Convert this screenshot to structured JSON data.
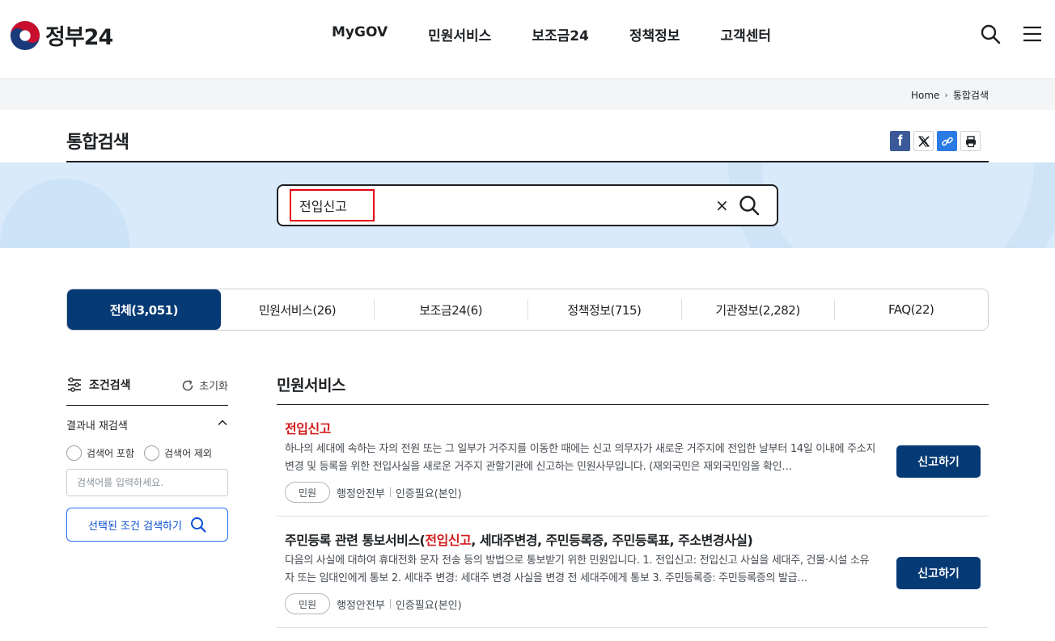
{
  "header": {
    "logo_text": "정부24",
    "nav": [
      "MyGOV",
      "민원서비스",
      "보조금24",
      "정책정보",
      "고객센터"
    ],
    "icons": [
      "search-icon",
      "menu-icon"
    ]
  },
  "breadcrumb": {
    "home": "Home",
    "current": "통합검색"
  },
  "page": {
    "title": "통합검색",
    "share_icons": [
      "facebook-icon",
      "x-icon",
      "link-icon",
      "print-icon"
    ]
  },
  "search": {
    "value": "전입신고",
    "clear_label": "×"
  },
  "tabs": [
    {
      "label": "전체(3,051)",
      "active": true
    },
    {
      "label": "민원서비스(26)",
      "active": false
    },
    {
      "label": "보조금24(6)",
      "active": false
    },
    {
      "label": "정책정보(715)",
      "active": false
    },
    {
      "label": "기관정보(2,282)",
      "active": false
    },
    {
      "label": "FAQ(22)",
      "active": false
    }
  ],
  "filter": {
    "title": "조건검색",
    "reset_label": "초기화",
    "re_search_label": "결과내 재검색",
    "include_label": "검색어 포함",
    "exclude_label": "검색어 제외",
    "keyword_placeholder": "검색어를 입력하세요.",
    "submit_label": "선택된 조건 검색하기"
  },
  "results": {
    "section_title": "민원서비스",
    "items": [
      {
        "title_pre": "",
        "title_hl": "전입신고",
        "title_post": "",
        "desc": "하나의 세대에 속하는 자의 전원 또는 그 일부가 거주지를 이동한 때에는 신고 의무자가 새로운 거주지에 전입한 날부터 14일 이내에 주소지변경 및 등록을 위한 전입사실을 새로운 거주지 관할기관에 신고하는 민원사무입니다. (재외국민은 재외국민임을 확인…",
        "tag": "민원",
        "agency": "행정안전부",
        "auth": "인증필요(본인)",
        "button": "신고하기"
      },
      {
        "title_pre": "주민등록 관련 통보서비스(",
        "title_hl": "전입신고",
        "title_post": ", 세대주변경, 주민등록증, 주민등록표, 주소변경사실)",
        "desc": "다음의 사실에 대하여 휴대전화 문자 전송 등의 방법으로 통보받기 위한 민원입니다. 1. 전입신고: 전입신고 사실을 세대주, 건물·시설 소유자 또는 임대인에게 통보 2. 세대주 변경: 세대주 변경 사실을 변경 전 세대주에게 통보 3. 주민등록증: 주민등록증의 발급…",
        "tag": "민원",
        "agency": "행정안전부",
        "auth": "인증필요(본인)",
        "button": "신고하기"
      }
    ]
  }
}
